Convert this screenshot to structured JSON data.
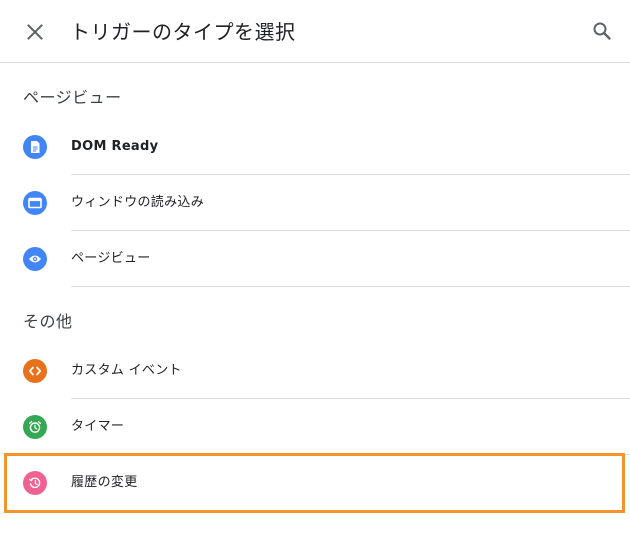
{
  "header": {
    "title": "トリガーのタイプを選択",
    "close_icon": "close-icon",
    "search_icon": "search-icon"
  },
  "sections": [
    {
      "title": "ページビュー",
      "items": [
        {
          "label": "DOM Ready",
          "icon": "document-icon",
          "color": "#4285f4",
          "bold": true
        },
        {
          "label": "ウィンドウの読み込み",
          "icon": "window-icon",
          "color": "#4285f4",
          "bold": false
        },
        {
          "label": "ページビュー",
          "icon": "eye-icon",
          "color": "#4285f4",
          "bold": false
        }
      ]
    },
    {
      "title": "その他",
      "items": [
        {
          "label": "カスタム イベント",
          "icon": "code-icon",
          "color": "#e8711c",
          "bold": false
        },
        {
          "label": "タイマー",
          "icon": "alarm-icon",
          "color": "#34a853",
          "bold": false
        },
        {
          "label": "履歴の変更",
          "icon": "history-icon",
          "color": "#f06292",
          "bold": false
        }
      ]
    }
  ],
  "highlight_color": "#f3952d"
}
